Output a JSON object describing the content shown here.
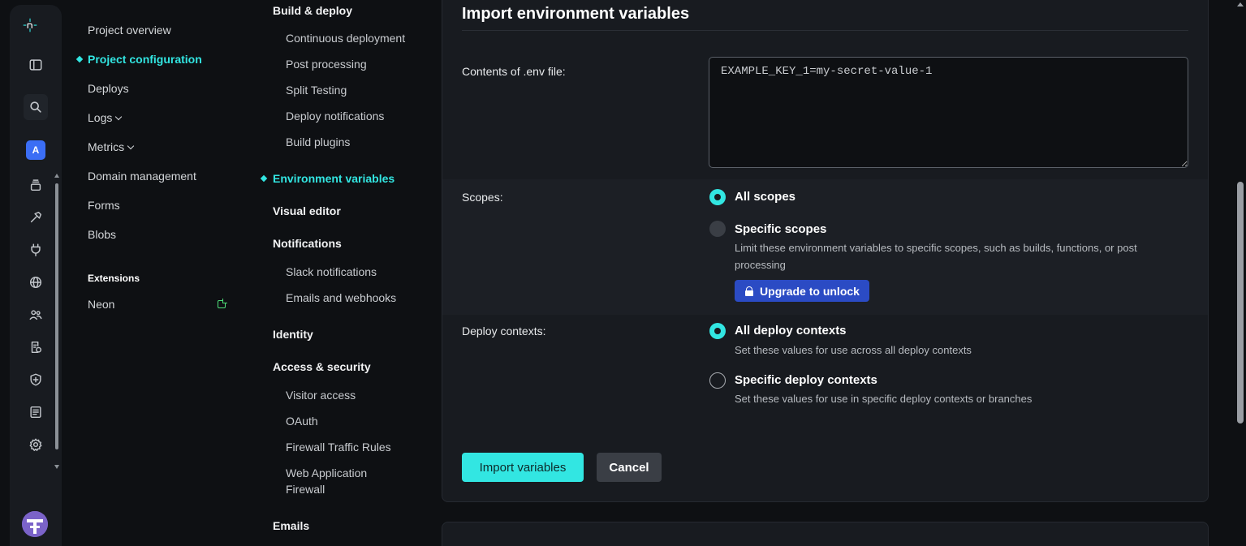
{
  "rail": {
    "account_initial": "A",
    "icons": [
      "netlify-logo-icon",
      "sidebar-toggle-icon",
      "search-icon",
      "deploys-stack-icon",
      "build-hammer-icon",
      "plug-icon",
      "globe-icon",
      "team-icon",
      "logs-doc-icon",
      "shield-icon",
      "billing-receipt-icon",
      "settings-gear-icon"
    ]
  },
  "nav1": {
    "project_overview": "Project overview",
    "project_configuration": "Project configuration",
    "deploys": "Deploys",
    "logs": "Logs",
    "metrics": "Metrics",
    "domain_management": "Domain management",
    "forms": "Forms",
    "blobs": "Blobs",
    "extensions_heading": "Extensions",
    "neon": "Neon"
  },
  "nav2": {
    "build_deploy": "Build & deploy",
    "continuous_deployment": "Continuous deployment",
    "post_processing": "Post processing",
    "split_testing": "Split Testing",
    "deploy_notifications": "Deploy notifications",
    "build_plugins": "Build plugins",
    "environment_variables": "Environment variables",
    "visual_editor": "Visual editor",
    "notifications": "Notifications",
    "slack_notifications": "Slack notifications",
    "emails_webhooks": "Emails and webhooks",
    "identity": "Identity",
    "access_security": "Access & security",
    "visitor_access": "Visitor access",
    "oauth": "OAuth",
    "firewall_traffic_rules": "Firewall Traffic Rules",
    "waf_line1": "Web Application",
    "waf_line2": "Firewall",
    "emails": "Emails"
  },
  "form": {
    "title": "Import environment variables",
    "env_label": "Contents of .env file:",
    "env_value": "EXAMPLE_KEY_1=my-secret-value-1",
    "scopes_label": "Scopes:",
    "all_scopes": "All scopes",
    "specific_scopes": "Specific scopes",
    "specific_scopes_desc": "Limit these environment variables to specific scopes, such as builds, functions, or post processing",
    "upgrade": "Upgrade to unlock",
    "contexts_label": "Deploy contexts:",
    "all_contexts": "All deploy contexts",
    "all_contexts_desc": "Set these values for use across all deploy contexts",
    "specific_contexts": "Specific deploy contexts",
    "specific_contexts_desc": "Set these values for use in specific deploy contexts or branches",
    "import_button": "Import variables",
    "cancel_button": "Cancel"
  },
  "colors": {
    "accent": "#32e6e2",
    "background": "#0e1013",
    "card": "#181b20",
    "upgrade": "#2b4bc4"
  }
}
